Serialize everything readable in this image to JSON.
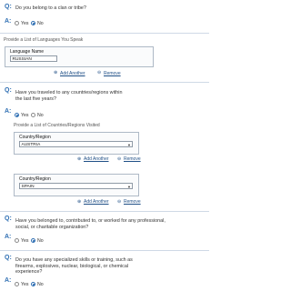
{
  "labels": {
    "q": "Q:",
    "a": "A:",
    "yes": "Yes",
    "no": "No",
    "add_another": "Add Another",
    "remove": "Remove"
  },
  "q1": {
    "question": "Do you belong to a clan or tribe?",
    "answer": "No"
  },
  "languages": {
    "title": "Provide a List of Languages You Speak",
    "field_label": "Language Name",
    "value": "RUSSIAN"
  },
  "q2": {
    "question": "Have you traveled to any countries/regions within the last five years?",
    "answer": "Yes",
    "list_title": "Provide a List of Countries/Regions Visited",
    "field_label": "Country/Region",
    "entries": [
      "AUSTRIA",
      "SPAIN"
    ]
  },
  "q3": {
    "question": "Have you belonged to, contributed to, or worked for any professional, social, or charitable organization?",
    "answer": "No"
  },
  "q4": {
    "question": "Do you have any specialized skills or training, such as firearms, explosives, nuclear, biological, or chemical experience?",
    "answer": "No"
  },
  "colors": {
    "accent": "#2f6fb3",
    "link": "#1f4f86",
    "divider": "#cfd9e6"
  }
}
